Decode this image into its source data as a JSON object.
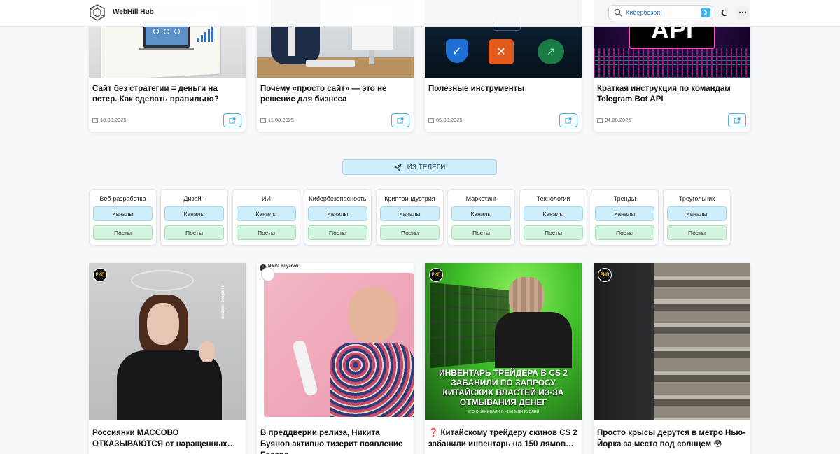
{
  "header": {
    "brand": "WebHill Hub",
    "search_value": "Кибербезоп|"
  },
  "articles": [
    {
      "title": "Сайт без стратегии = деньги на ветер. Как сделать правильно?",
      "date": "18.08.2025"
    },
    {
      "title": "Почему «просто сайт» — это не решение для бизнеса",
      "date": "11.08.2025"
    },
    {
      "title": "Полезные инструменты",
      "date": "05.08.2025"
    },
    {
      "title": "Краткая инструкция по командам Telegram Bot API",
      "date": "04.08.2025",
      "image_text": "API"
    }
  ],
  "telegram_button": "ИЗ ТЕЛЕГИ",
  "categories": [
    {
      "name": "Веб-разработка",
      "channels": "Каналы",
      "posts": "Посты"
    },
    {
      "name": "Дизайн",
      "channels": "Каналы",
      "posts": "Посты"
    },
    {
      "name": "ИИ",
      "channels": "Каналы",
      "posts": "Посты"
    },
    {
      "name": "Кибербезопасность",
      "channels": "Каналы",
      "posts": "Посты"
    },
    {
      "name": "Криптоиндустрия",
      "channels": "Каналы",
      "posts": "Посты"
    },
    {
      "name": "Маркетинг",
      "channels": "Каналы",
      "posts": "Посты"
    },
    {
      "name": "Технологии",
      "channels": "Каналы",
      "posts": "Посты"
    },
    {
      "name": "Тренды",
      "channels": "Каналы",
      "posts": "Посты"
    },
    {
      "name": "Треугольник",
      "channels": "Каналы",
      "posts": "Посты"
    }
  ],
  "posts": [
    {
      "title": "Россиянки МАССОВО ОТКАЗЫВАЮТСЯ от наращенных…",
      "badge": "РИП",
      "side_text": "видео: соцсети"
    },
    {
      "title": "В преддверии релиза, Никита Буянов активно тизерит появление Escape…",
      "tweet_author": "Nikita Buyanov"
    },
    {
      "title": "❓ Китайскому трейдеру скинов CS 2 забанили инвентарь на 150 лямов…",
      "badge": "РИП",
      "headline": "ИНВЕНТАРЬ ТРЕЙДЕРА В CS 2 ЗАБАНИЛИ ПО ЗАПРОСУ КИТАЙСКИХ ВЛАСТЕЙ ИЗ-ЗА ОТМЫВАНИЯ ДЕНЕГ",
      "subline": "ЕГО ОЦЕНИВАЛИ В ≈150 МЛН РУБЛЕЙ"
    },
    {
      "title": "Просто крысы дерутся в метро Нью-Йорка за место под солнцем 😳",
      "badge": "РИП"
    }
  ]
}
